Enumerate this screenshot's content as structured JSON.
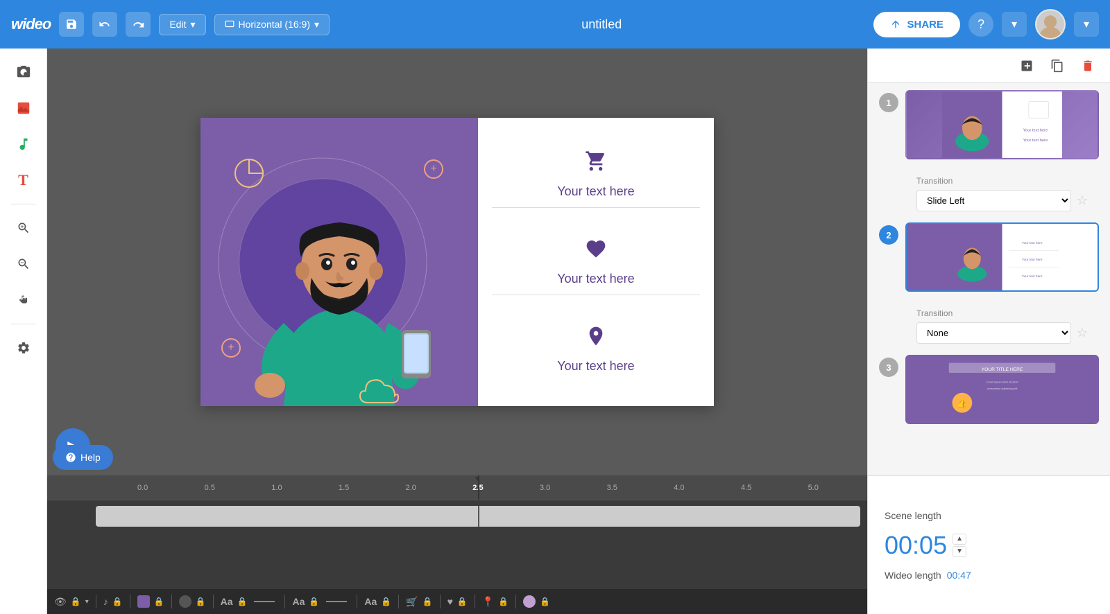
{
  "topbar": {
    "logo": "wideo",
    "save_icon": "💾",
    "undo_icon": "↩",
    "redo_icon": "↪",
    "edit_label": "Edit",
    "format_label": "Horizontal (16:9)",
    "title": "untitled",
    "share_label": "SHARE",
    "help_icon": "?",
    "dropdown_icon": "▾"
  },
  "left_toolbar": {
    "tools": [
      {
        "name": "camera-tool",
        "icon": "📷",
        "label": "Camera"
      },
      {
        "name": "image-tool",
        "icon": "🖼",
        "label": "Image"
      },
      {
        "name": "music-tool",
        "icon": "♪",
        "label": "Music"
      },
      {
        "name": "text-tool",
        "icon": "T",
        "label": "Text"
      },
      {
        "name": "zoom-in-tool",
        "icon": "🔍+",
        "label": "Zoom In"
      },
      {
        "name": "zoom-out-tool",
        "icon": "🔍-",
        "label": "Zoom Out"
      },
      {
        "name": "hand-tool",
        "icon": "✋",
        "label": "Pan"
      },
      {
        "name": "settings-tool",
        "icon": "⚙",
        "label": "Settings"
      }
    ]
  },
  "canvas": {
    "slide_sections": [
      {
        "icon": "🛒",
        "text": "Your text here"
      },
      {
        "icon": "♥",
        "text": "Your text here"
      },
      {
        "icon": "📍",
        "text": "Your text here"
      }
    ]
  },
  "timeline": {
    "ruler_marks": [
      "0.0",
      "0.5",
      "1.0",
      "1.5",
      "2.0",
      "2.5",
      "3.0",
      "3.5",
      "4.0",
      "4.5",
      "5.0"
    ],
    "play_icon": "▶",
    "current_time": "2.5"
  },
  "right_panel": {
    "add_icon": "+",
    "duplicate_icon": "⧉",
    "delete_icon": "🗑",
    "slides": [
      {
        "num": "1",
        "active": false,
        "transition_label": "Transition",
        "transition_value": "Slide Left"
      },
      {
        "num": "2",
        "active": true,
        "transition_label": "Transition",
        "transition_value": "None"
      },
      {
        "num": "3",
        "active": false
      }
    ]
  },
  "scene_length": {
    "label": "Scene length",
    "time": "00:05",
    "wideo_length_label": "Wideo length",
    "wideo_length_time": "00:47"
  },
  "help": {
    "label": "Help"
  }
}
